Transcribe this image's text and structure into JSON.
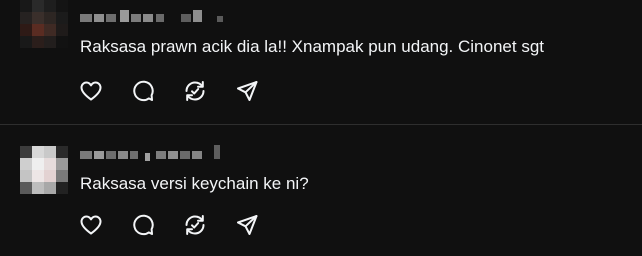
{
  "comments": [
    {
      "text": "Raksasa prawn acik dia la!! Xnampak pun udang. Cinonet sgt",
      "actions": [
        "heart-icon",
        "comment-icon",
        "repost-icon",
        "share-icon"
      ]
    },
    {
      "text": "Raksasa versi keychain ke ni?",
      "actions": [
        "heart-icon",
        "comment-icon",
        "repost-icon",
        "share-icon"
      ]
    }
  ],
  "colors": {
    "background": "#101010",
    "text": "#f3f5f7",
    "icon": "#f3f5f7",
    "divider": "#2e2e2e",
    "redacted": "#8d8d8d"
  }
}
